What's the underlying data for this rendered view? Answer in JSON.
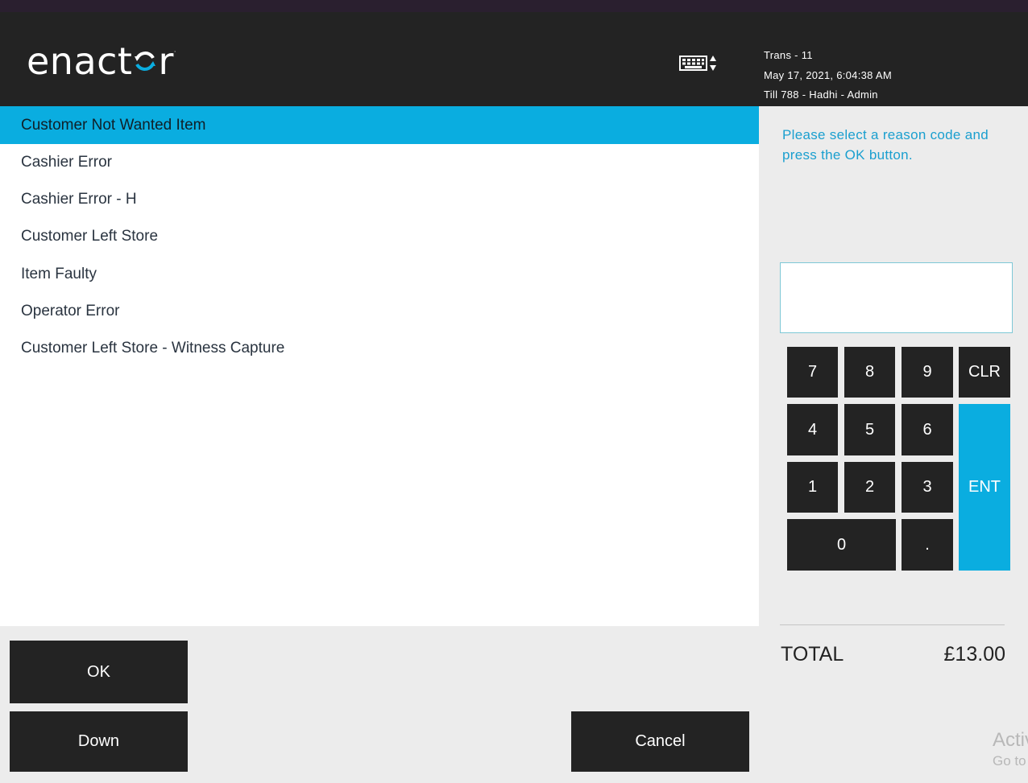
{
  "header": {
    "logo_text": "enact",
    "logo_text_end": "r",
    "logo_tm": "·",
    "keyboard_icon": "keyboard-toggle-icon",
    "trans": "Trans - 11",
    "datetime": "May 17, 2021, 6:04:38 AM",
    "till": "Till 788 - Hadhi - Admin"
  },
  "reasons": [
    "Customer Not Wanted Item",
    "Cashier Error",
    "Cashier Error - H",
    "Customer Left Store",
    "Item Faulty",
    "Operator Error",
    "Customer Left Store - Witness Capture"
  ],
  "selected_reason": "Customer Not Wanted Item",
  "instruction": "Please select a reason code and press the OK button.",
  "entry_value": "",
  "keypad": {
    "k7": "7",
    "k8": "8",
    "k9": "9",
    "clr": "CLR",
    "k4": "4",
    "k5": "5",
    "k6": "6",
    "k1": "1",
    "k2": "2",
    "k3": "3",
    "ent": "ENT",
    "k0": "0",
    "dot": "."
  },
  "total": {
    "label": "TOTAL",
    "value": "£13.00"
  },
  "buttons": {
    "ok": "OK",
    "down": "Down",
    "cancel": "Cancel"
  },
  "watermark": {
    "line1": "Activate Windows",
    "line2": "Go to Settings to activate Windows."
  },
  "colors": {
    "accent": "#0aade0",
    "dark": "#232323",
    "header": "#232323",
    "instruction": "#1a9fcf"
  }
}
